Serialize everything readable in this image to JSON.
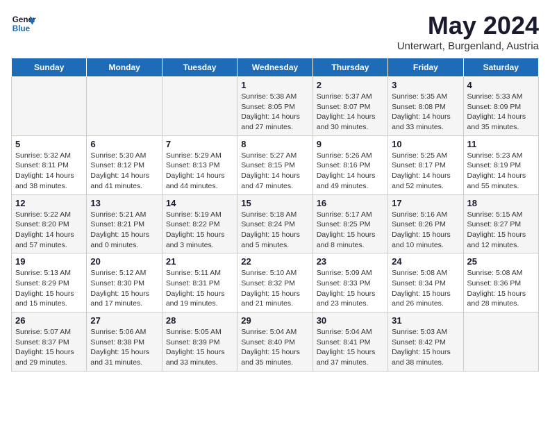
{
  "logo": {
    "line1": "General",
    "line2": "Blue"
  },
  "title": "May 2024",
  "subtitle": "Unterwart, Burgenland, Austria",
  "days_of_week": [
    "Sunday",
    "Monday",
    "Tuesday",
    "Wednesday",
    "Thursday",
    "Friday",
    "Saturday"
  ],
  "weeks": [
    [
      {
        "day": "",
        "info": ""
      },
      {
        "day": "",
        "info": ""
      },
      {
        "day": "",
        "info": ""
      },
      {
        "day": "1",
        "info": "Sunrise: 5:38 AM\nSunset: 8:05 PM\nDaylight: 14 hours and 27 minutes."
      },
      {
        "day": "2",
        "info": "Sunrise: 5:37 AM\nSunset: 8:07 PM\nDaylight: 14 hours and 30 minutes."
      },
      {
        "day": "3",
        "info": "Sunrise: 5:35 AM\nSunset: 8:08 PM\nDaylight: 14 hours and 33 minutes."
      },
      {
        "day": "4",
        "info": "Sunrise: 5:33 AM\nSunset: 8:09 PM\nDaylight: 14 hours and 35 minutes."
      }
    ],
    [
      {
        "day": "5",
        "info": "Sunrise: 5:32 AM\nSunset: 8:11 PM\nDaylight: 14 hours and 38 minutes."
      },
      {
        "day": "6",
        "info": "Sunrise: 5:30 AM\nSunset: 8:12 PM\nDaylight: 14 hours and 41 minutes."
      },
      {
        "day": "7",
        "info": "Sunrise: 5:29 AM\nSunset: 8:13 PM\nDaylight: 14 hours and 44 minutes."
      },
      {
        "day": "8",
        "info": "Sunrise: 5:27 AM\nSunset: 8:15 PM\nDaylight: 14 hours and 47 minutes."
      },
      {
        "day": "9",
        "info": "Sunrise: 5:26 AM\nSunset: 8:16 PM\nDaylight: 14 hours and 49 minutes."
      },
      {
        "day": "10",
        "info": "Sunrise: 5:25 AM\nSunset: 8:17 PM\nDaylight: 14 hours and 52 minutes."
      },
      {
        "day": "11",
        "info": "Sunrise: 5:23 AM\nSunset: 8:19 PM\nDaylight: 14 hours and 55 minutes."
      }
    ],
    [
      {
        "day": "12",
        "info": "Sunrise: 5:22 AM\nSunset: 8:20 PM\nDaylight: 14 hours and 57 minutes."
      },
      {
        "day": "13",
        "info": "Sunrise: 5:21 AM\nSunset: 8:21 PM\nDaylight: 15 hours and 0 minutes."
      },
      {
        "day": "14",
        "info": "Sunrise: 5:19 AM\nSunset: 8:22 PM\nDaylight: 15 hours and 3 minutes."
      },
      {
        "day": "15",
        "info": "Sunrise: 5:18 AM\nSunset: 8:24 PM\nDaylight: 15 hours and 5 minutes."
      },
      {
        "day": "16",
        "info": "Sunrise: 5:17 AM\nSunset: 8:25 PM\nDaylight: 15 hours and 8 minutes."
      },
      {
        "day": "17",
        "info": "Sunrise: 5:16 AM\nSunset: 8:26 PM\nDaylight: 15 hours and 10 minutes."
      },
      {
        "day": "18",
        "info": "Sunrise: 5:15 AM\nSunset: 8:27 PM\nDaylight: 15 hours and 12 minutes."
      }
    ],
    [
      {
        "day": "19",
        "info": "Sunrise: 5:13 AM\nSunset: 8:29 PM\nDaylight: 15 hours and 15 minutes."
      },
      {
        "day": "20",
        "info": "Sunrise: 5:12 AM\nSunset: 8:30 PM\nDaylight: 15 hours and 17 minutes."
      },
      {
        "day": "21",
        "info": "Sunrise: 5:11 AM\nSunset: 8:31 PM\nDaylight: 15 hours and 19 minutes."
      },
      {
        "day": "22",
        "info": "Sunrise: 5:10 AM\nSunset: 8:32 PM\nDaylight: 15 hours and 21 minutes."
      },
      {
        "day": "23",
        "info": "Sunrise: 5:09 AM\nSunset: 8:33 PM\nDaylight: 15 hours and 23 minutes."
      },
      {
        "day": "24",
        "info": "Sunrise: 5:08 AM\nSunset: 8:34 PM\nDaylight: 15 hours and 26 minutes."
      },
      {
        "day": "25",
        "info": "Sunrise: 5:08 AM\nSunset: 8:36 PM\nDaylight: 15 hours and 28 minutes."
      }
    ],
    [
      {
        "day": "26",
        "info": "Sunrise: 5:07 AM\nSunset: 8:37 PM\nDaylight: 15 hours and 29 minutes."
      },
      {
        "day": "27",
        "info": "Sunrise: 5:06 AM\nSunset: 8:38 PM\nDaylight: 15 hours and 31 minutes."
      },
      {
        "day": "28",
        "info": "Sunrise: 5:05 AM\nSunset: 8:39 PM\nDaylight: 15 hours and 33 minutes."
      },
      {
        "day": "29",
        "info": "Sunrise: 5:04 AM\nSunset: 8:40 PM\nDaylight: 15 hours and 35 minutes."
      },
      {
        "day": "30",
        "info": "Sunrise: 5:04 AM\nSunset: 8:41 PM\nDaylight: 15 hours and 37 minutes."
      },
      {
        "day": "31",
        "info": "Sunrise: 5:03 AM\nSunset: 8:42 PM\nDaylight: 15 hours and 38 minutes."
      },
      {
        "day": "",
        "info": ""
      }
    ]
  ]
}
